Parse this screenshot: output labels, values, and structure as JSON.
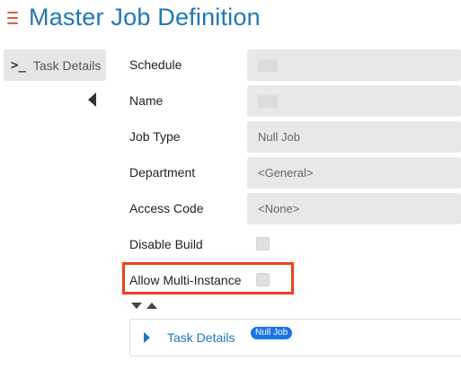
{
  "header": {
    "title": "Master Job Definition",
    "menu_icon": "hamburger-menu-icon",
    "accent_color": "#1f78b4",
    "menu_color": "#e05a4a"
  },
  "sidebar": {
    "tab_icon": ">_",
    "tab_label": "Task Details",
    "collapse_icon": "caret-left-icon"
  },
  "form": {
    "schedule": {
      "label": "Schedule",
      "value": ""
    },
    "name": {
      "label": "Name",
      "value": ""
    },
    "job_type": {
      "label": "Job Type",
      "value": "Null Job"
    },
    "department": {
      "label": "Department",
      "value": "<General>"
    },
    "access_code": {
      "label": "Access Code",
      "value": "<None>"
    },
    "disable_build": {
      "label": "Disable Build",
      "checked": false
    },
    "allow_multi_instance": {
      "label": "Allow Multi-Instance",
      "checked": false,
      "highlight_color": "#e8421c"
    }
  },
  "sort_controls": {
    "down_icon": "triangle-down-icon",
    "up_icon": "triangle-up-icon"
  },
  "task_panel": {
    "expand_icon": "caret-right-icon",
    "label": "Task Details",
    "badge": "Null Job",
    "badge_color": "#1a73e8"
  }
}
